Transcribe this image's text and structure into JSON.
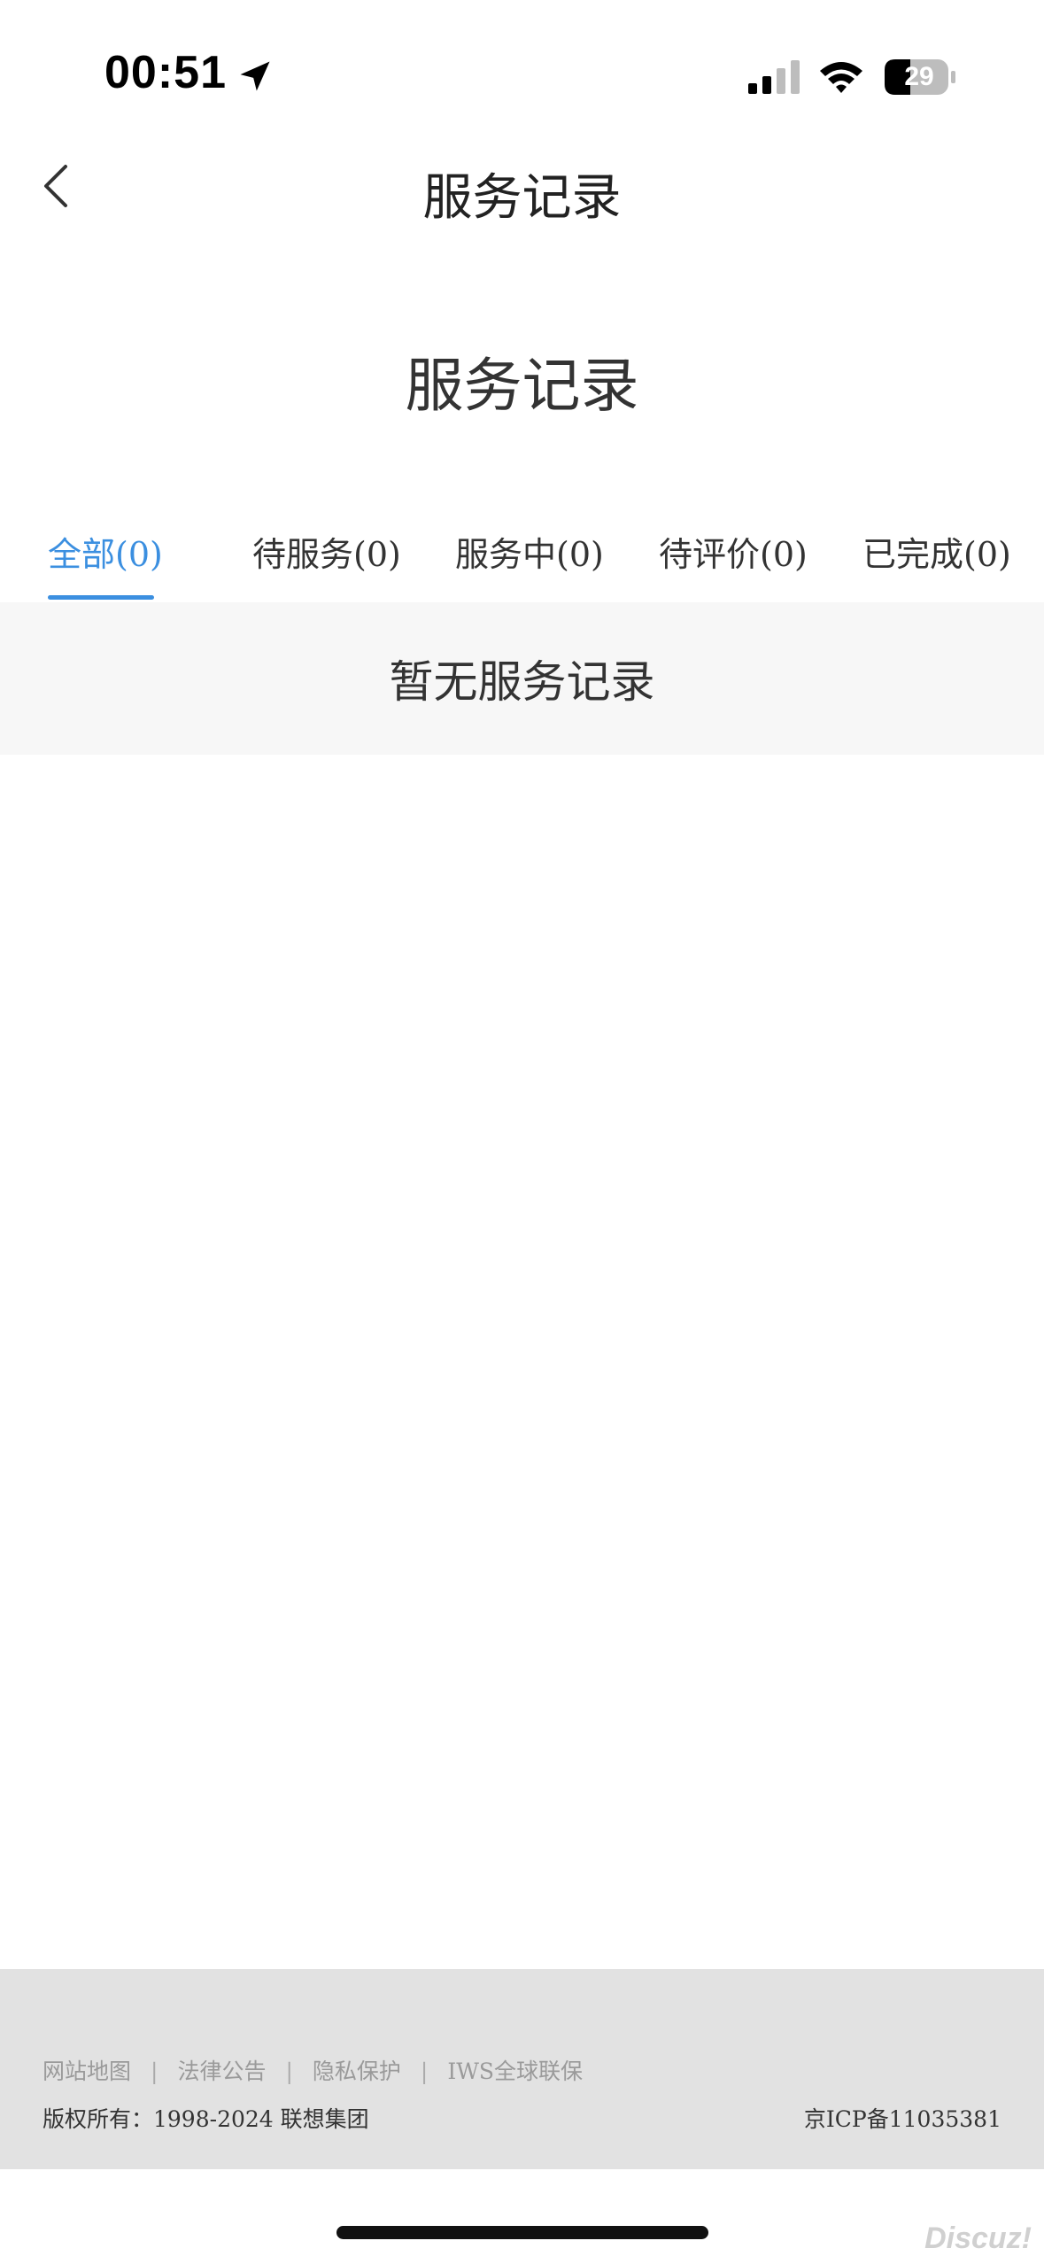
{
  "status_bar": {
    "time": "00:51",
    "battery": "29",
    "icons": [
      "location-arrow-icon",
      "cellular-signal-icon",
      "wifi-icon",
      "battery-icon"
    ]
  },
  "nav": {
    "title": "服务记录",
    "back_icon": "chevron-left-icon"
  },
  "page": {
    "heading": "服务记录"
  },
  "tabs": [
    {
      "label": "全部(0)",
      "active": true
    },
    {
      "label": "待服务(0)",
      "active": false
    },
    {
      "label": "服务中(0)",
      "active": false
    },
    {
      "label": "待评价(0)",
      "active": false
    },
    {
      "label": "已完成(0)",
      "active": false
    }
  ],
  "empty_state": {
    "text": "暂无服务记录"
  },
  "footer": {
    "links": [
      "网站地图",
      "法律公告",
      "隐私保护",
      "IWS全球联保"
    ],
    "separator": "|",
    "copyright": "版权所有：1998-2024 联想集团",
    "icp": "京ICP备11035381"
  },
  "watermark": "Discuz!",
  "colors": {
    "accent": "#3b8fe0",
    "footer_bg": "#e2e2e2",
    "empty_bg": "#f7f7f7"
  }
}
